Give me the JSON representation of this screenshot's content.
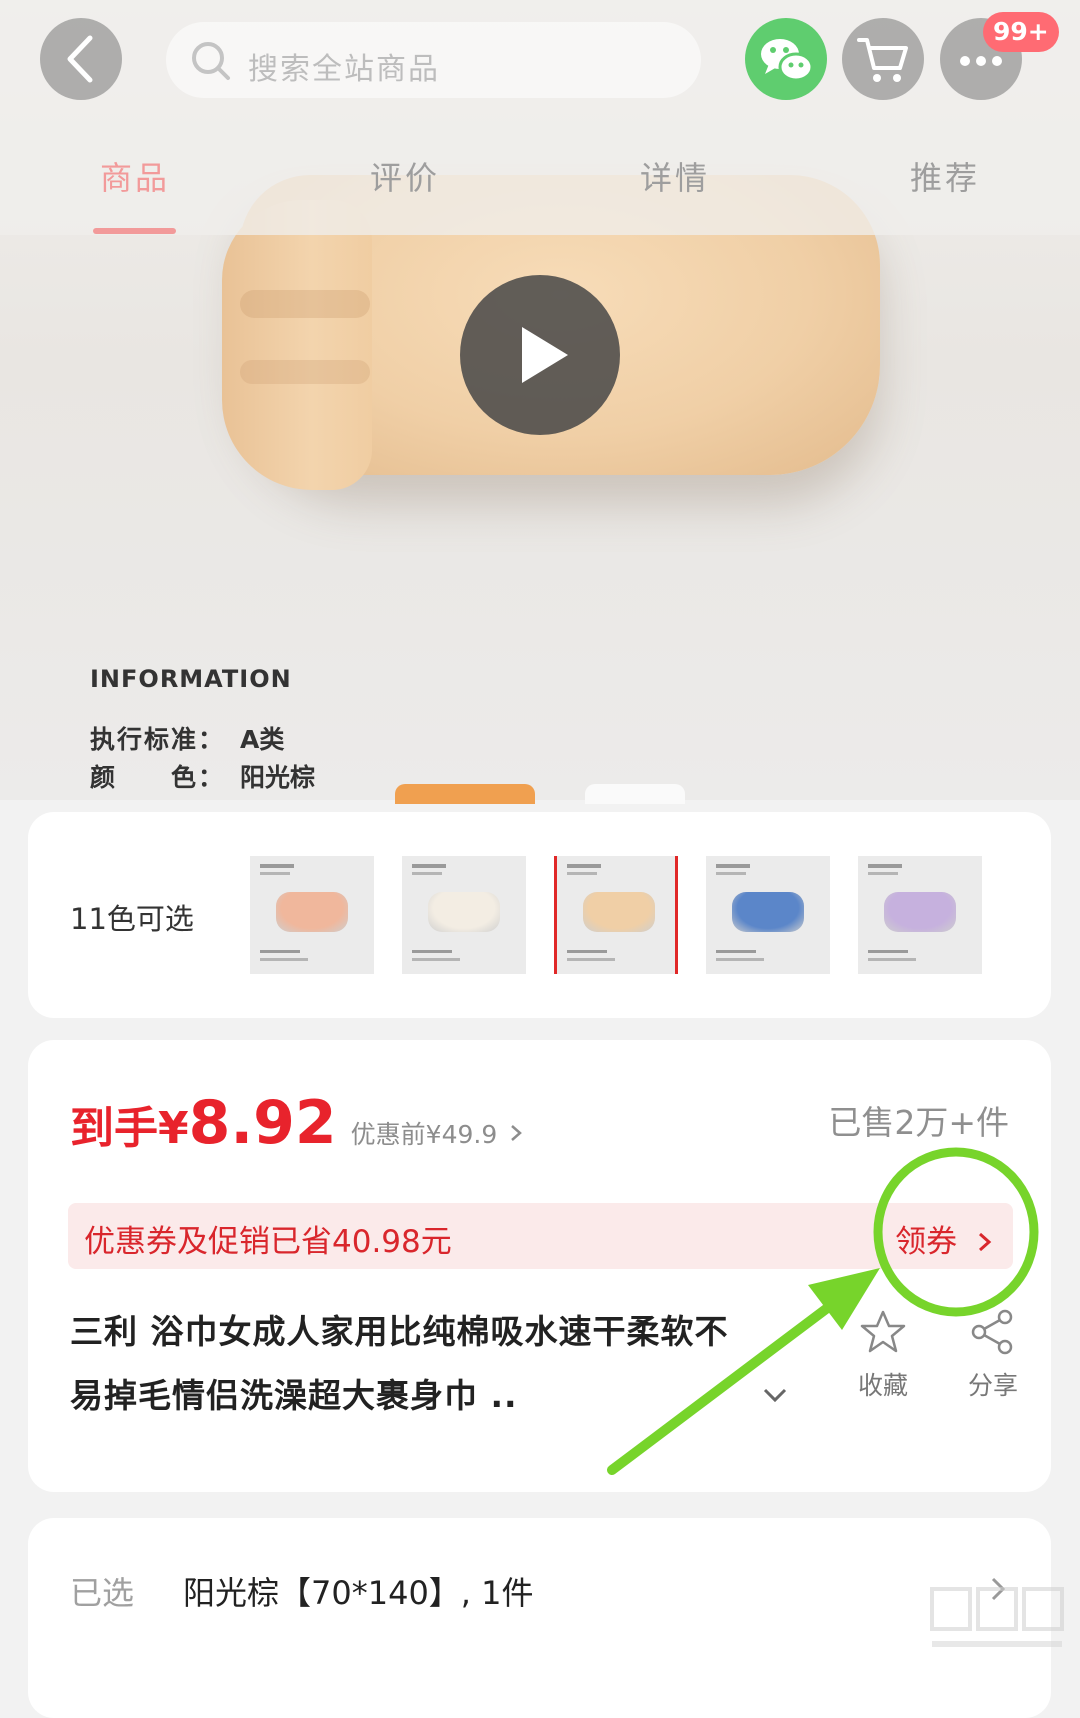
{
  "header": {
    "search_placeholder": "搜索全站商品",
    "badge": "99+"
  },
  "tabs": [
    {
      "label": "商品",
      "active": true
    },
    {
      "label": "评价",
      "active": false
    },
    {
      "label": "详情",
      "active": false
    },
    {
      "label": "推荐",
      "active": false
    }
  ],
  "hero": {
    "info_title": "INFORMATION",
    "info_lines": [
      {
        "key": "执行标准：",
        "value": "A类"
      },
      {
        "key": "颜　　色：",
        "value": "阳光棕"
      }
    ]
  },
  "colors": {
    "label": "11色可选",
    "swatches": [
      {
        "color": "#f0b79c"
      },
      {
        "color": "#f3ede3"
      },
      {
        "color": "#f0cfa6",
        "selected": true
      },
      {
        "color": "#5b86c9"
      },
      {
        "color": "#c6b1de"
      }
    ]
  },
  "price": {
    "prefix": "到手¥",
    "value": "8.92",
    "original": "优惠前¥49.9",
    "sold": "已售2万+件"
  },
  "promo": {
    "text": "优惠券及促销已省40.98元",
    "coupon_label": "领券"
  },
  "product": {
    "title": "三利 浴巾女成人家用比纯棉吸水速干柔软不易掉毛情侣洗澡超大裹身巾 ..",
    "favorite_label": "收藏",
    "share_label": "分享"
  },
  "selection": {
    "label": "已选",
    "value": "阳光棕【70*140】, 1件"
  },
  "colors_theme": {
    "accent_red": "#e8232c",
    "annotation_green": "#77d42b",
    "tab_active": "#f29a9a"
  }
}
